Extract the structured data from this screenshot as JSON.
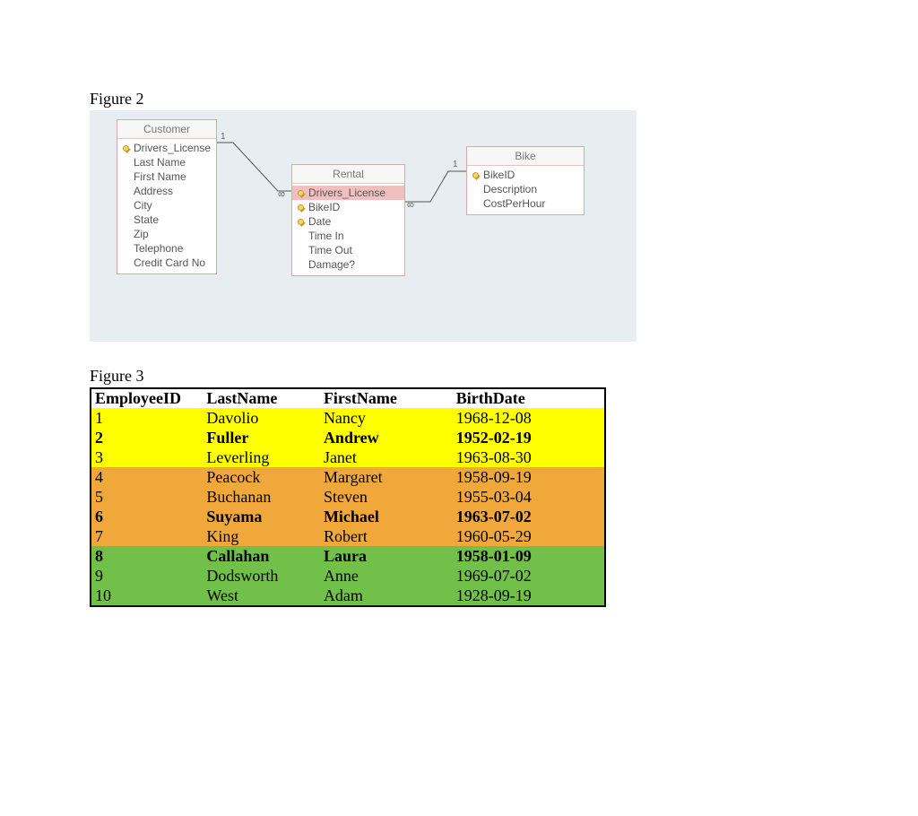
{
  "figure2": {
    "title": "Figure 2",
    "tables": {
      "customer": {
        "name": "Customer",
        "fields": [
          {
            "label": "Drivers_License",
            "key": true
          },
          {
            "label": "Last Name"
          },
          {
            "label": "First Name"
          },
          {
            "label": "Address"
          },
          {
            "label": "City"
          },
          {
            "label": "State"
          },
          {
            "label": "Zip"
          },
          {
            "label": "Telephone"
          },
          {
            "label": "Credit Card No"
          }
        ]
      },
      "rental": {
        "name": "Rental",
        "fields": [
          {
            "label": "Drivers_License",
            "key": true,
            "highlight": true
          },
          {
            "label": "BikeID",
            "key": true
          },
          {
            "label": "Date",
            "key": true
          },
          {
            "label": "Time In"
          },
          {
            "label": "Time Out"
          },
          {
            "label": "Damage?"
          }
        ]
      },
      "bike": {
        "name": "Bike",
        "fields": [
          {
            "label": "BikeID",
            "key": true
          },
          {
            "label": "Description"
          },
          {
            "label": "CostPerHour"
          }
        ]
      }
    },
    "relations": {
      "r1": {
        "end1": "1",
        "endInf": "∞"
      },
      "r2": {
        "end1": "1",
        "endInf": "∞"
      }
    }
  },
  "figure3": {
    "title": "Figure 3",
    "headers": {
      "c1": "EmployeeID",
      "c2": "LastName",
      "c3": "FirstName",
      "c4": "BirthDate"
    },
    "rows": [
      {
        "id": "1",
        "ln": "Davolio",
        "fn": "Nancy",
        "bd": "1968-12-08",
        "color": "yellow",
        "bold": false
      },
      {
        "id": "2",
        "ln": "Fuller",
        "fn": "Andrew",
        "bd": "1952-02-19",
        "color": "yellow",
        "bold": true
      },
      {
        "id": "3",
        "ln": "Leverling",
        "fn": "Janet",
        "bd": "1963-08-30",
        "color": "yellow",
        "bold": false
      },
      {
        "id": "4",
        "ln": "Peacock",
        "fn": "Margaret",
        "bd": "1958-09-19",
        "color": "orange",
        "bold": false
      },
      {
        "id": "5",
        "ln": "Buchanan",
        "fn": "Steven",
        "bd": "1955-03-04",
        "color": "orange",
        "bold": false
      },
      {
        "id": "6",
        "ln": "Suyama",
        "fn": "Michael",
        "bd": "1963-07-02",
        "color": "orange",
        "bold": true
      },
      {
        "id": "7",
        "ln": "King",
        "fn": "Robert",
        "bd": "1960-05-29",
        "color": "orange",
        "bold": false
      },
      {
        "id": "8",
        "ln": "Callahan",
        "fn": "Laura",
        "bd": "1958-01-09",
        "color": "green",
        "bold": true
      },
      {
        "id": "9",
        "ln": "Dodsworth",
        "fn": "Anne",
        "bd": "1969-07-02",
        "color": "green",
        "bold": false
      },
      {
        "id": "10",
        "ln": "West",
        "fn": "Adam",
        "bd": "1928-09-19",
        "color": "green",
        "bold": false
      }
    ]
  },
  "chart_data": {
    "type": "table",
    "title": "Employee table (Figure 3)",
    "columns": [
      "EmployeeID",
      "LastName",
      "FirstName",
      "BirthDate"
    ],
    "rows": [
      [
        1,
        "Davolio",
        "Nancy",
        "1968-12-08"
      ],
      [
        2,
        "Fuller",
        "Andrew",
        "1952-02-19"
      ],
      [
        3,
        "Leverling",
        "Janet",
        "1963-08-30"
      ],
      [
        4,
        "Peacock",
        "Margaret",
        "1958-09-19"
      ],
      [
        5,
        "Buchanan",
        "Steven",
        "1955-03-04"
      ],
      [
        6,
        "Suyama",
        "Michael",
        "1963-07-02"
      ],
      [
        7,
        "King",
        "Robert",
        "1960-05-29"
      ],
      [
        8,
        "Callahan",
        "Laura",
        "1958-01-09"
      ],
      [
        9,
        "Dodsworth",
        "Anne",
        "1969-07-02"
      ],
      [
        10,
        "West",
        "Adam",
        "1928-09-19"
      ]
    ],
    "row_colors": [
      "yellow",
      "yellow",
      "yellow",
      "orange",
      "orange",
      "orange",
      "orange",
      "green",
      "green",
      "green"
    ]
  }
}
